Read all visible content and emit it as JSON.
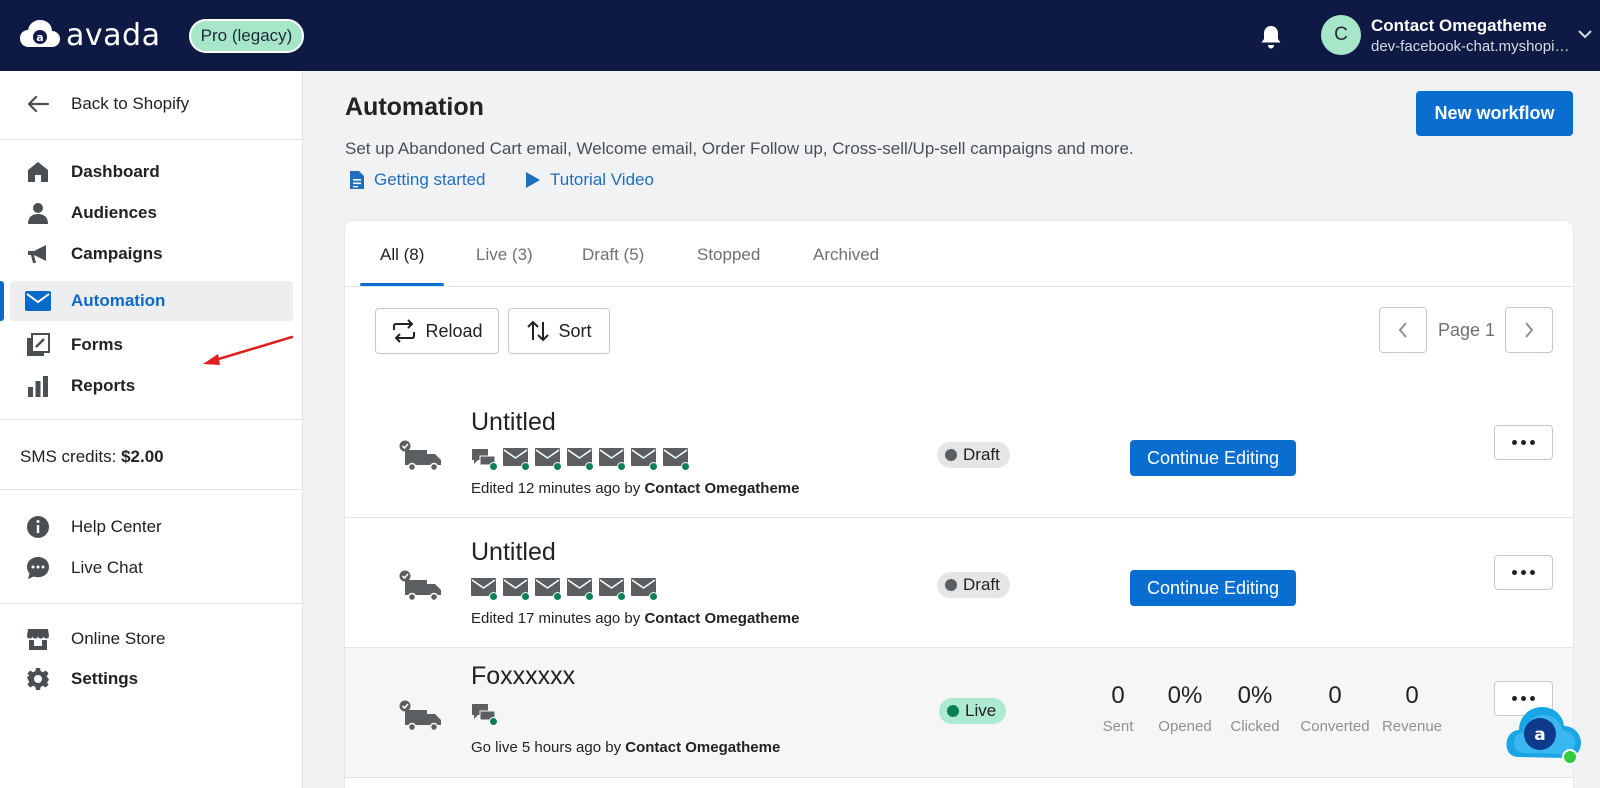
{
  "topbar": {
    "logo_text": "avada",
    "plan_badge": "Pro (legacy)",
    "user": {
      "avatar_initial": "C",
      "name": "Contact Omegatheme",
      "shop": "dev-facebook-chat.myshopify.com"
    }
  },
  "sidebar": {
    "back_label": "Back to Shopify",
    "nav_items": [
      {
        "label": "Dashboard",
        "icon": "home-icon"
      },
      {
        "label": "Audiences",
        "icon": "person-icon"
      },
      {
        "label": "Campaigns",
        "icon": "megaphone-icon"
      },
      {
        "label": "Automation",
        "icon": "mail-icon",
        "active": true
      },
      {
        "label": "Forms",
        "icon": "forms-icon"
      },
      {
        "label": "Reports",
        "icon": "bar-chart-icon"
      }
    ],
    "sms_label": "SMS credits:",
    "sms_value": "$2.00",
    "help_items": [
      {
        "label": "Help Center",
        "icon": "info-icon"
      },
      {
        "label": "Live Chat",
        "icon": "chat-icon"
      }
    ],
    "store_items": [
      {
        "label": "Online Store",
        "icon": "store-icon"
      },
      {
        "label": "Settings",
        "icon": "gear-icon"
      }
    ]
  },
  "main": {
    "title": "Automation",
    "subtitle": "Set up Abandoned Cart email, Welcome email, Order Follow up, Cross-sell/Up-sell campaigns and more.",
    "new_button": "New workflow",
    "links": {
      "getting_started": "Getting started",
      "tutorial": "Tutorial Video"
    },
    "tabs": [
      "All (8)",
      "Live (3)",
      "Draft (5)",
      "Stopped",
      "Archived"
    ],
    "active_tab": 0,
    "toolbar": {
      "reload": "Reload",
      "sort": "Sort",
      "page_label": "Page 1"
    },
    "workflows": [
      {
        "title": "Untitled",
        "steps": [
          "sms",
          "email",
          "email",
          "email",
          "email",
          "email",
          "email"
        ],
        "meta_prefix": "Edited 12 minutes ago by",
        "meta_user": "Contact Omegatheme",
        "status": "Draft",
        "action": "Continue Editing"
      },
      {
        "title": "Untitled",
        "steps": [
          "email",
          "email",
          "email",
          "email",
          "email",
          "email"
        ],
        "meta_prefix": "Edited 17 minutes ago by",
        "meta_user": "Contact Omegatheme",
        "status": "Draft",
        "action": "Continue Editing"
      },
      {
        "title": "Foxxxxxx",
        "steps": [
          "sms"
        ],
        "meta_prefix": "Go live 5 hours ago by",
        "meta_user": "Contact Omegatheme",
        "status": "Live",
        "stats": [
          {
            "value": "0",
            "label": "Sent"
          },
          {
            "value": "0%",
            "label": "Opened"
          },
          {
            "value": "0%",
            "label": "Clicked"
          },
          {
            "value": "0",
            "label": "Converted"
          },
          {
            "value": "0",
            "label": "Revenue"
          }
        ]
      }
    ]
  },
  "colors": {
    "topbar_bg": "#0e1a44",
    "primary": "#0a6ed1",
    "draft_badge": "#e4e5e7",
    "live_badge": "#aee9d1",
    "live_dot": "#0a8052",
    "annotation_arrow": "#e02020"
  }
}
